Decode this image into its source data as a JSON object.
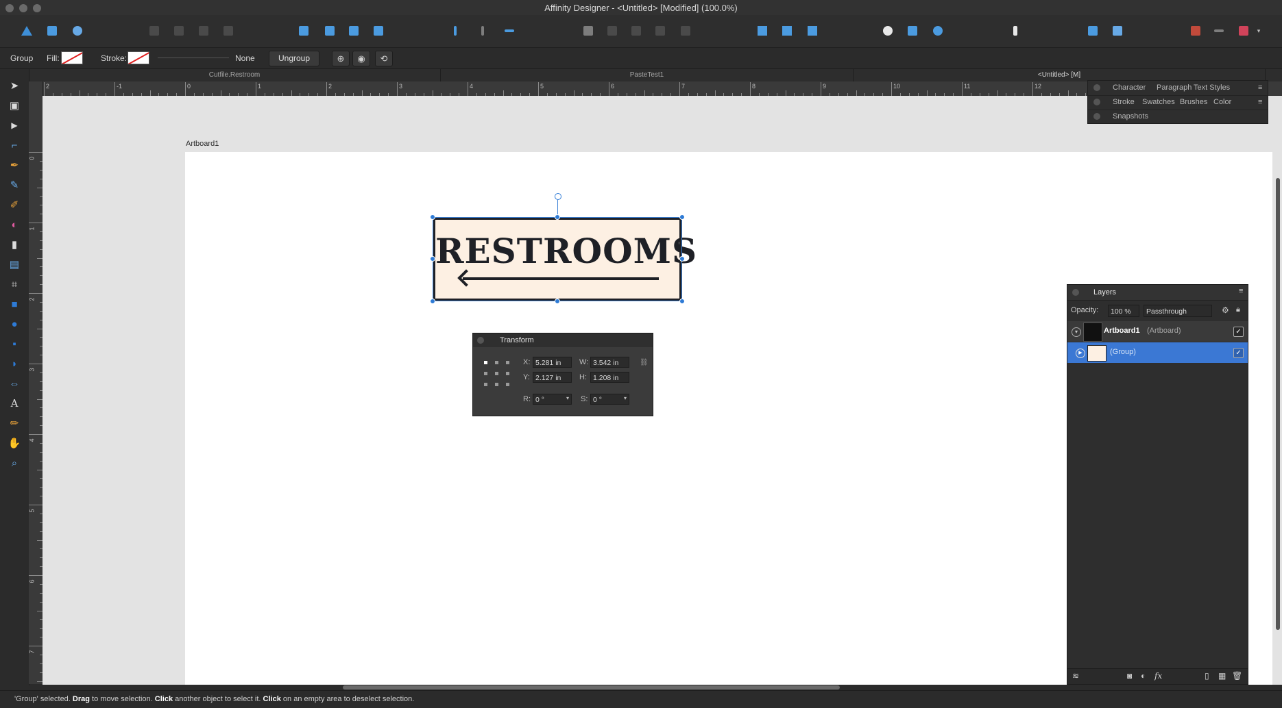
{
  "window": {
    "title": "Affinity Designer - <Untitled> [Modified] (100.0%)"
  },
  "context_bar": {
    "selection_type": "Group",
    "fill_label": "Fill:",
    "stroke_label": "Stroke:",
    "stroke_width": "None",
    "ungroup_label": "Ungroup"
  },
  "tabs": [
    {
      "label": "Cutfile.Restroom"
    },
    {
      "label": "PasteTest1"
    },
    {
      "label": "<Untitled> [M]"
    }
  ],
  "ruler": {
    "unit": "in",
    "top_numbers": [
      "2",
      "-1",
      "0",
      "1",
      "2",
      "3",
      "4",
      "5",
      "6",
      "7",
      "8",
      "9",
      "10",
      "11",
      "12"
    ],
    "left_numbers": [
      "0",
      "1",
      "2",
      "3",
      "4",
      "5",
      "6",
      "7"
    ]
  },
  "artboard": {
    "label": "Artboard1"
  },
  "sign": {
    "text": "RESTROOMS"
  },
  "transform": {
    "title": "Transform",
    "x_label": "X:",
    "x_value": "5.281 in",
    "y_label": "Y:",
    "y_value": "2.127 in",
    "w_label": "W:",
    "w_value": "3.542 in",
    "h_label": "H:",
    "h_value": "1.208 in",
    "r_label": "R:",
    "r_value": "0 °",
    "s_label": "S:",
    "s_value": "0 °"
  },
  "studio_tabs": {
    "row1": [
      "Character",
      "Paragraph",
      "Text Styles"
    ],
    "row2": [
      "Stroke",
      "Swatches",
      "Brushes",
      "Color"
    ],
    "row3": [
      "Snapshots"
    ]
  },
  "layers": {
    "title": "Layers",
    "opacity_label": "Opacity:",
    "opacity_value": "100 %",
    "blend_mode": "Passthrough",
    "items": [
      {
        "name": "Artboard1",
        "type": "(Artboard)",
        "visible": true
      },
      {
        "name": "",
        "type": "(Group)",
        "visible": true
      }
    ]
  },
  "status": {
    "pre": "'Group' selected.",
    "b1": "Drag",
    "t1": "to move selection.",
    "b2": "Click",
    "t2": "another object to select it.",
    "b3": "Click",
    "t3": "on an empty area to deselect selection."
  },
  "colors": {
    "accent": "#2e7bd6",
    "sign_background": "#fdf0e3",
    "sign_ink": "#1e2026",
    "selected_layer": "#3b78d4"
  }
}
